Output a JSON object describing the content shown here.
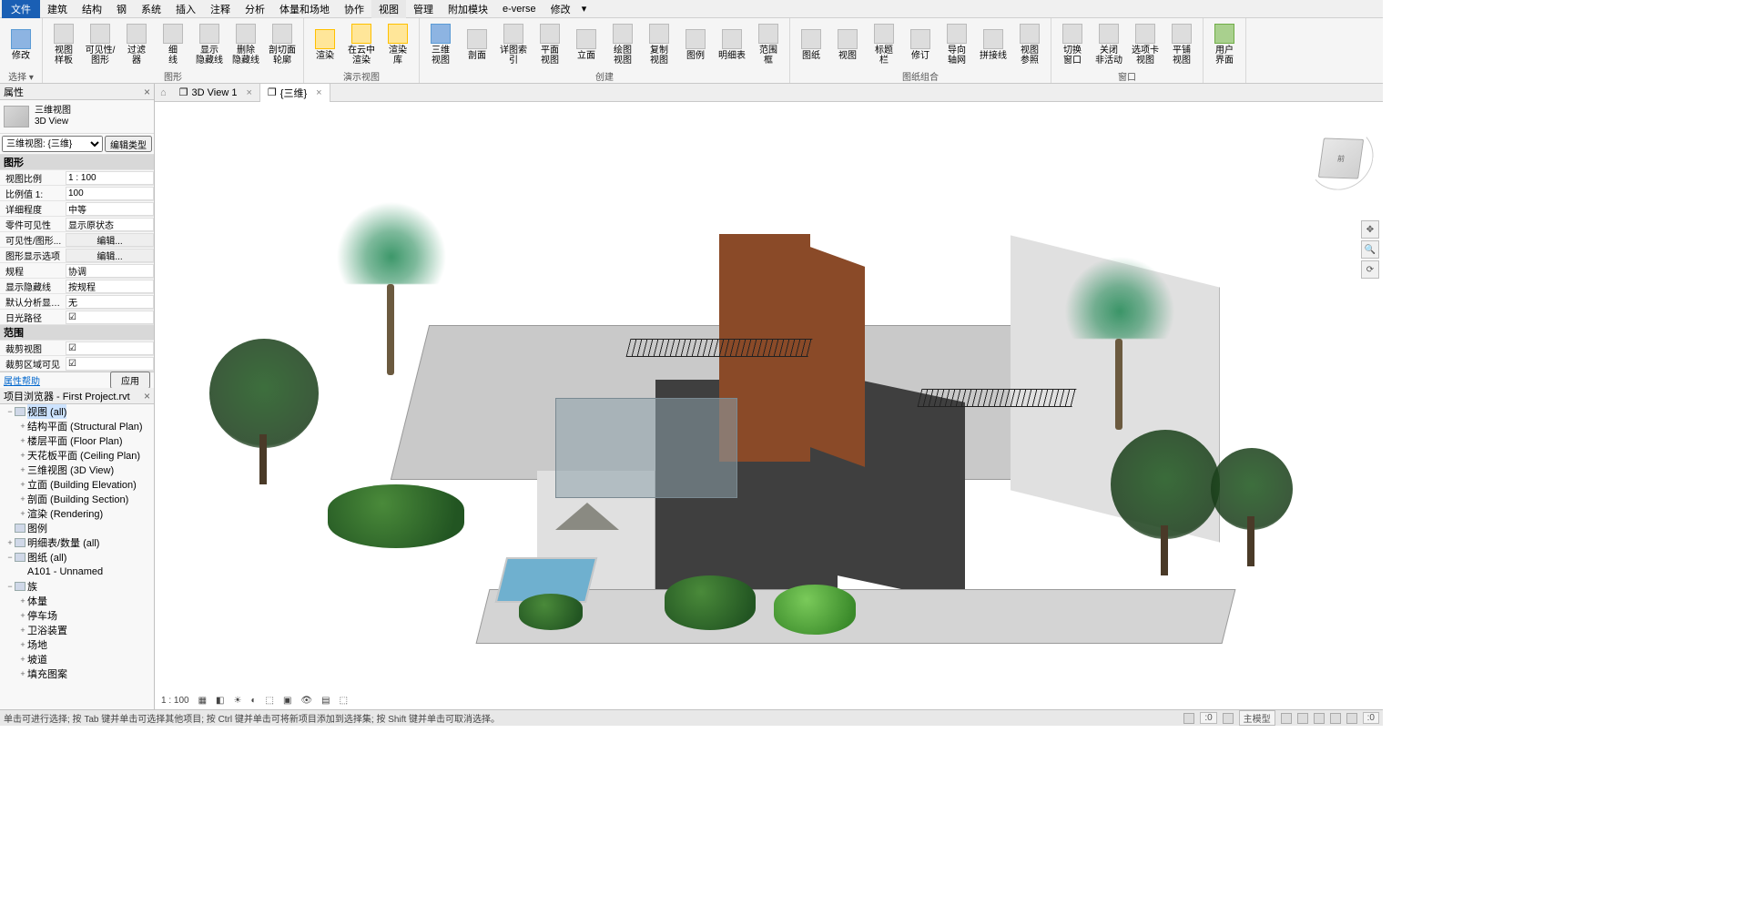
{
  "menu": {
    "file": "文件",
    "tabs": [
      "建筑",
      "结构",
      "钢",
      "系统",
      "插入",
      "注释",
      "分析",
      "体量和场地",
      "协作",
      "视图",
      "管理",
      "附加模块",
      "e-verse",
      "修改"
    ],
    "active": "视图",
    "extra": "▾"
  },
  "ribbon": {
    "groups": [
      {
        "label": "选择 ▾",
        "tools": [
          {
            "l": "修改",
            "c": "blue"
          }
        ]
      },
      {
        "label": "图形",
        "tools": [
          {
            "l": "视图\n样板",
            "c": ""
          },
          {
            "l": "可见性/\n图形",
            "c": ""
          },
          {
            "l": "过滤\n器",
            "c": ""
          },
          {
            "l": "细\n线",
            "c": ""
          },
          {
            "l": "显示\n隐藏线",
            "c": ""
          },
          {
            "l": "删除\n隐藏线",
            "c": ""
          },
          {
            "l": "剖切面\n轮廓",
            "c": ""
          }
        ]
      },
      {
        "label": "演示视图",
        "tools": [
          {
            "l": "渲染",
            "c": "yellow"
          },
          {
            "l": "在云中\n渲染",
            "c": "yellow"
          },
          {
            "l": "渲染\n库",
            "c": "yellow"
          }
        ]
      },
      {
        "label": "创建",
        "tools": [
          {
            "l": "三维\n视图",
            "c": "blue"
          },
          {
            "l": "剖面",
            "c": ""
          },
          {
            "l": "详图索引",
            "c": ""
          },
          {
            "l": "平面\n视图",
            "c": ""
          },
          {
            "l": "立面",
            "c": ""
          },
          {
            "l": "绘图\n视图",
            "c": ""
          },
          {
            "l": "复制\n视图",
            "c": ""
          },
          {
            "l": "图例",
            "c": ""
          },
          {
            "l": "明细表",
            "c": ""
          },
          {
            "l": "范围\n框",
            "c": ""
          }
        ]
      },
      {
        "label": "图纸组合",
        "tools": [
          {
            "l": "图纸",
            "c": ""
          },
          {
            "l": "视图",
            "c": ""
          },
          {
            "l": "标题\n栏",
            "c": ""
          },
          {
            "l": "修订",
            "c": ""
          },
          {
            "l": "导向\n轴网",
            "c": ""
          },
          {
            "l": "拼接线",
            "c": ""
          },
          {
            "l": "视图\n参照",
            "c": ""
          }
        ]
      },
      {
        "label": "窗口",
        "tools": [
          {
            "l": "切换\n窗口",
            "c": ""
          },
          {
            "l": "关闭\n非活动",
            "c": ""
          },
          {
            "l": "选项卡\n视图",
            "c": ""
          },
          {
            "l": "平铺\n视图",
            "c": ""
          }
        ]
      },
      {
        "label": "",
        "tools": [
          {
            "l": "用户\n界面",
            "c": "green"
          }
        ]
      }
    ]
  },
  "properties": {
    "title": "属性",
    "type_name_1": "三维视图",
    "type_name_2": "3D View",
    "selector": "三维视图: {三维}",
    "edit_type": "编辑类型",
    "section_graphics": "图形",
    "rows": [
      {
        "k": "视图比例",
        "v": "1 : 100"
      },
      {
        "k": "比例值 1:",
        "v": "100"
      },
      {
        "k": "详细程度",
        "v": "中等"
      },
      {
        "k": "零件可见性",
        "v": "显示原状态"
      },
      {
        "k": "可见性/图形...",
        "v": "编辑...",
        "btn": true
      },
      {
        "k": "图形显示选项",
        "v": "编辑...",
        "btn": true
      },
      {
        "k": "规程",
        "v": "协调"
      },
      {
        "k": "显示隐藏线",
        "v": "按规程"
      },
      {
        "k": "默认分析显示...",
        "v": "无"
      },
      {
        "k": "日光路径",
        "v": "",
        "chk": true
      }
    ],
    "section_extents": "范围",
    "rows2": [
      {
        "k": "裁剪视图",
        "v": "",
        "chk": true
      },
      {
        "k": "裁剪区域可见",
        "v": "",
        "chk": true
      }
    ],
    "help": "属性帮助",
    "apply": "应用"
  },
  "browser": {
    "title": "项目浏览器 - First Project.rvt",
    "tree": [
      {
        "l": 1,
        "exp": "−",
        "t": "视图 (all)",
        "icon": true,
        "active": true
      },
      {
        "l": 2,
        "exp": "+",
        "t": "结构平面 (Structural Plan)"
      },
      {
        "l": 2,
        "exp": "+",
        "t": "楼层平面 (Floor Plan)"
      },
      {
        "l": 2,
        "exp": "+",
        "t": "天花板平面 (Ceiling Plan)"
      },
      {
        "l": 2,
        "exp": "+",
        "t": "三维视图 (3D View)"
      },
      {
        "l": 2,
        "exp": "+",
        "t": "立面 (Building Elevation)"
      },
      {
        "l": 2,
        "exp": "+",
        "t": "剖面 (Building Section)"
      },
      {
        "l": 2,
        "exp": "+",
        "t": "渲染 (Rendering)"
      },
      {
        "l": 1,
        "exp": "",
        "t": "图例",
        "icon": true
      },
      {
        "l": 1,
        "exp": "+",
        "t": "明细表/数量 (all)",
        "icon": true
      },
      {
        "l": 1,
        "exp": "−",
        "t": "图纸 (all)",
        "icon": true
      },
      {
        "l": 2,
        "exp": "",
        "t": "A101 - Unnamed"
      },
      {
        "l": 1,
        "exp": "−",
        "t": "族",
        "icon": true
      },
      {
        "l": 2,
        "exp": "+",
        "t": "体量"
      },
      {
        "l": 2,
        "exp": "+",
        "t": "停车场"
      },
      {
        "l": 2,
        "exp": "+",
        "t": "卫浴装置"
      },
      {
        "l": 2,
        "exp": "+",
        "t": "场地"
      },
      {
        "l": 2,
        "exp": "+",
        "t": "坡道"
      },
      {
        "l": 2,
        "exp": "+",
        "t": "填充图案"
      }
    ]
  },
  "viewtabs": {
    "tabs": [
      {
        "name": "3D View 1",
        "active": false
      },
      {
        "name": "{三维}",
        "active": true
      }
    ],
    "home": "⌂"
  },
  "viewcube": "前",
  "scale_display": "1 : 100",
  "statusbar": {
    "hint": "单击可进行选择; 按 Tab 键并单击可选择其他项目; 按 Ctrl 键并单击可将新项目添加到选择集; 按 Shift 键并单击可取消选择。",
    "model": "主模型",
    "zero1": ":0",
    "zero2": ":0"
  }
}
